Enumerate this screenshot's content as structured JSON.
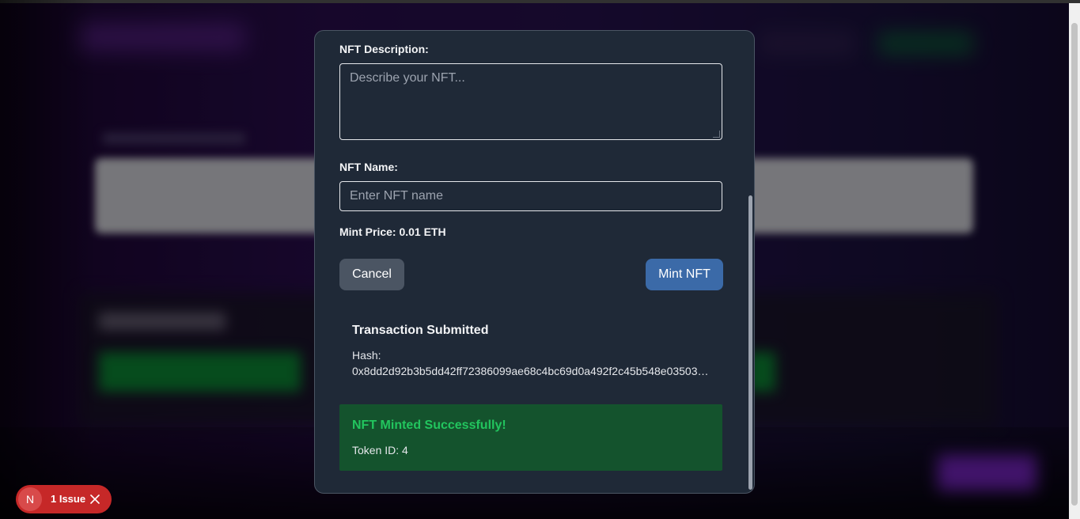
{
  "modal": {
    "description_label": "NFT Description:",
    "description_placeholder": "Describe your NFT...",
    "name_label": "NFT Name:",
    "name_placeholder": "Enter NFT name",
    "mint_price": "Mint Price: 0.01 ETH",
    "cancel_label": "Cancel",
    "mint_label": "Mint NFT"
  },
  "transaction": {
    "title": "Transaction Submitted",
    "hash_label": "Hash:",
    "hash_value": "0x8dd2d92b3b5dd42ff72386099ae68c4bc69d0a492f2c45b548e03503…"
  },
  "success": {
    "title": "NFT Minted Successfully!",
    "token": "Token ID: 4"
  },
  "issue_badge": {
    "logo": "N",
    "text": "1 Issue",
    "icon": "close-icon"
  },
  "colors": {
    "modal_bg": "#1f2937",
    "mint_button": "#3b6aa8",
    "cancel_button": "#4b5563",
    "success_bg": "#14532d",
    "success_text": "#22c55e",
    "issue_badge": "#c62828"
  }
}
